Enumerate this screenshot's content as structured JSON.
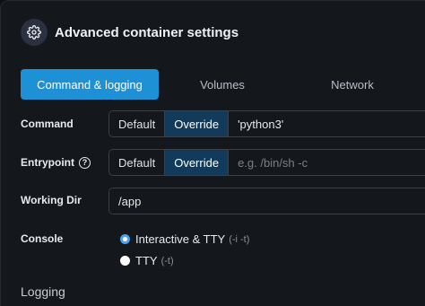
{
  "header": {
    "title": "Advanced container settings",
    "icon": "gear-icon"
  },
  "tabs": [
    {
      "label": "Command & logging",
      "active": true
    },
    {
      "label": "Volumes",
      "active": false
    },
    {
      "label": "Network",
      "active": false
    }
  ],
  "command": {
    "label": "Command",
    "options": [
      "Default",
      "Override"
    ],
    "selected": "Override",
    "value": "'python3'"
  },
  "entrypoint": {
    "label": "Entrypoint",
    "help_icon": "question-circle-icon",
    "options": [
      "Default",
      "Override"
    ],
    "selected": "Override",
    "placeholder": "e.g. /bin/sh -c"
  },
  "working_dir": {
    "label": "Working Dir",
    "value": "/app"
  },
  "console": {
    "label": "Console",
    "options": [
      {
        "label": "Interactive & TTY",
        "hint": "(-i -t)",
        "selected": true
      },
      {
        "label": "TTY",
        "hint": "(-t)",
        "selected": false
      }
    ]
  },
  "logging": {
    "title": "Logging"
  },
  "colors": {
    "accent": "#1e90d6",
    "selected_segment": "#123a5a",
    "background": "#14171c"
  }
}
